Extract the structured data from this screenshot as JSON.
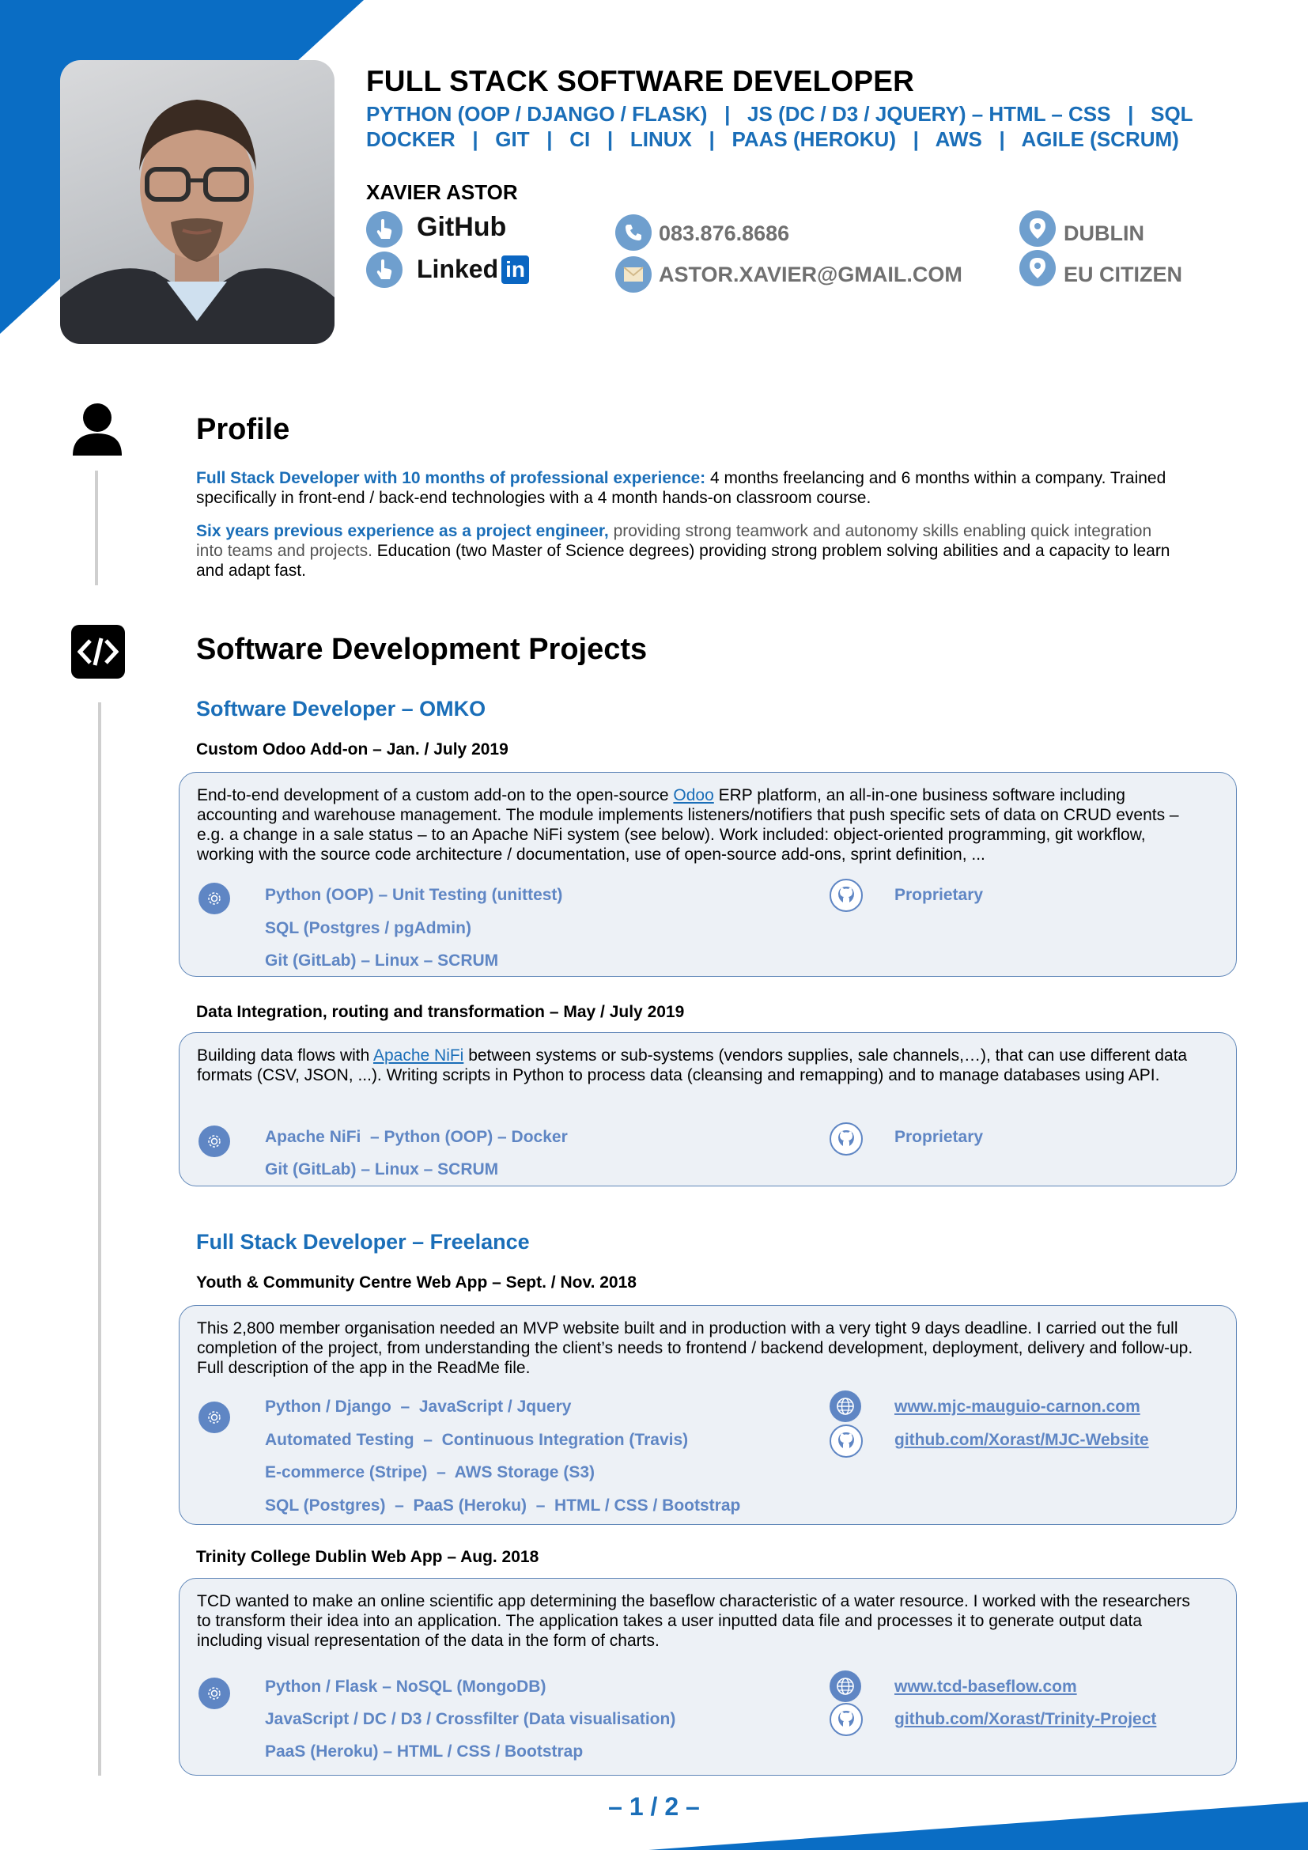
{
  "header": {
    "job_title": "FULL STACK SOFTWARE DEVELOPER",
    "skills_line1": "PYTHON (OOP / DJANGO / FLASK)   |   JS (DC / D3 / JQUERY) – HTML – CSS   |   SQL",
    "skills_line2": "DOCKER   |   GIT   |   CI   |   LINUX   |   PAAS (HEROKU)   |   AWS   |   AGILE (SCRUM)",
    "name": "XAVIER ASTOR",
    "github_label": "GitHub",
    "linkedin_label": "Linked",
    "linkedin_in": "in",
    "phone": "083.876.8686",
    "email": "ASTOR.XAVIER@GMAIL.COM",
    "location": "DUBLIN",
    "citizenship": "EU CITIZEN"
  },
  "profile": {
    "title": "Profile",
    "p1_highlight": "Full Stack Developer with 10 months of professional experience:",
    "p1_rest": " 4 months freelancing and 6 months within a company. Trained specifically in front-end / back-end technologies with a 4 month hands-on classroom course.",
    "p2_highlight": "Six years previous experience as a project engineer,",
    "p2_gray": " providing strong teamwork and autonomy skills enabling quick integration into teams and projects.",
    "p2_rest": " Education (two Master of Science degrees) providing strong problem solving abilities and a capacity to learn and adapt fast."
  },
  "projects": {
    "title": "Software Development Projects",
    "omko": {
      "title": "Software Developer – OMKO",
      "p1": {
        "title": "Custom Odoo Add-on – Jan. / July 2019",
        "desc_a": "End-to-end development of a custom add-on to the open-source ",
        "link": "Odoo",
        "desc_b": " ERP platform, an all-in-one business software including accounting and warehouse management. The module implements listeners/notifiers that push specific sets of data on CRUD events – e.g. a change in a sale status – to an Apache NiFi system (see below). Work included: object-oriented programming, git workflow, working with the source code architecture / documentation, use of open-source add-ons, sprint definition, ...",
        "tech": [
          "Python (OOP) – Unit Testing (unittest)",
          "SQL (Postgres / pgAdmin)",
          "Git (GitLab) – Linux – SCRUM"
        ],
        "repo": "Proprietary"
      },
      "p2": {
        "title": "Data Integration, routing and transformation – May / July 2019",
        "desc_a": "Building data flows with ",
        "link": "Apache NiFi",
        "desc_b": " between systems or sub-systems (vendors supplies, sale channels,…), that can use different data formats (CSV, JSON, ...). Writing scripts in Python to process data (cleansing and remapping) and to manage databases using API.",
        "tech": [
          "Apache NiFi  – Python (OOP) – Docker",
          "Git (GitLab) – Linux – SCRUM"
        ],
        "repo": "Proprietary"
      }
    },
    "freelance": {
      "title": "Full Stack Developer – Freelance",
      "p1": {
        "title": "Youth & Community Centre Web App – Sept. / Nov. 2018",
        "desc": "This 2,800 member organisation needed an MVP website built and in production with a very tight 9 days deadline. I carried out the full completion of the project, from understanding the client’s needs to frontend / backend development, deployment, delivery and follow-up. Full description of the app in the ReadMe file.",
        "tech": [
          "Python / Django  –  JavaScript / Jquery",
          "Automated Testing  –  Continuous Integration (Travis)",
          "E-commerce (Stripe)  –  AWS Storage (S3)",
          "SQL (Postgres)  –  PaaS (Heroku)  –  HTML / CSS / Bootstrap"
        ],
        "website": "www.mjc-mauguio-carnon.com",
        "repo": "github.com/Xorast/MJC-Website"
      },
      "p2": {
        "title": "Trinity College Dublin Web App – Aug. 2018",
        "desc": "TCD wanted to make an online scientific app determining the baseflow characteristic of a water resource. I worked with the researchers to transform their idea into an application. The application takes a user inputted data file and processes it to generate output data including visual representation of the data in the form of charts.",
        "tech": [
          "Python / Flask – NoSQL (MongoDB)",
          "JavaScript / DC / D3 / Crossfilter (Data visualisation)",
          "PaaS (Heroku) – HTML / CSS / Bootstrap"
        ],
        "website": "www.tcd-baseflow.com",
        "repo": "github.com/Xorast/Trinity-Project"
      }
    }
  },
  "footer": {
    "page": "– 1 / 2 –"
  }
}
